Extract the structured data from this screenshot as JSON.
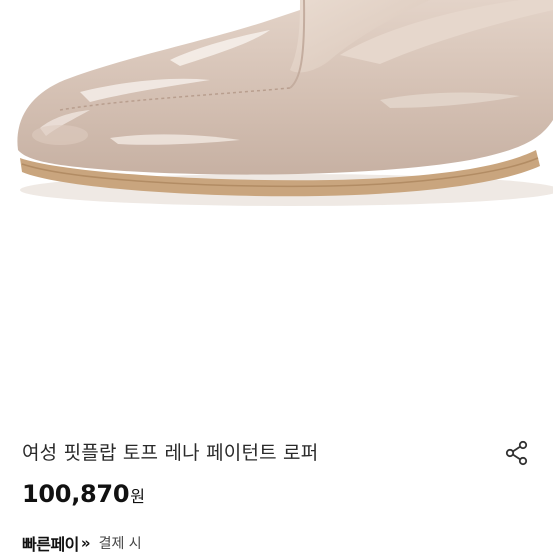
{
  "product": {
    "image_subject": "taupe patent leather loafer",
    "title": "여성 핏플랍 토프 레나 페이턴트 로퍼",
    "price": "100,870",
    "currency": "원"
  },
  "payment": {
    "logo": "빠른페이",
    "arrow": "»",
    "note": "결제 시"
  },
  "icons": {
    "share": "share-icon"
  },
  "colors": {
    "shoe_body": "#d6c3b6",
    "shoe_highlight": "#eee4dc",
    "sole": "#c9a57e",
    "text": "#222222"
  }
}
